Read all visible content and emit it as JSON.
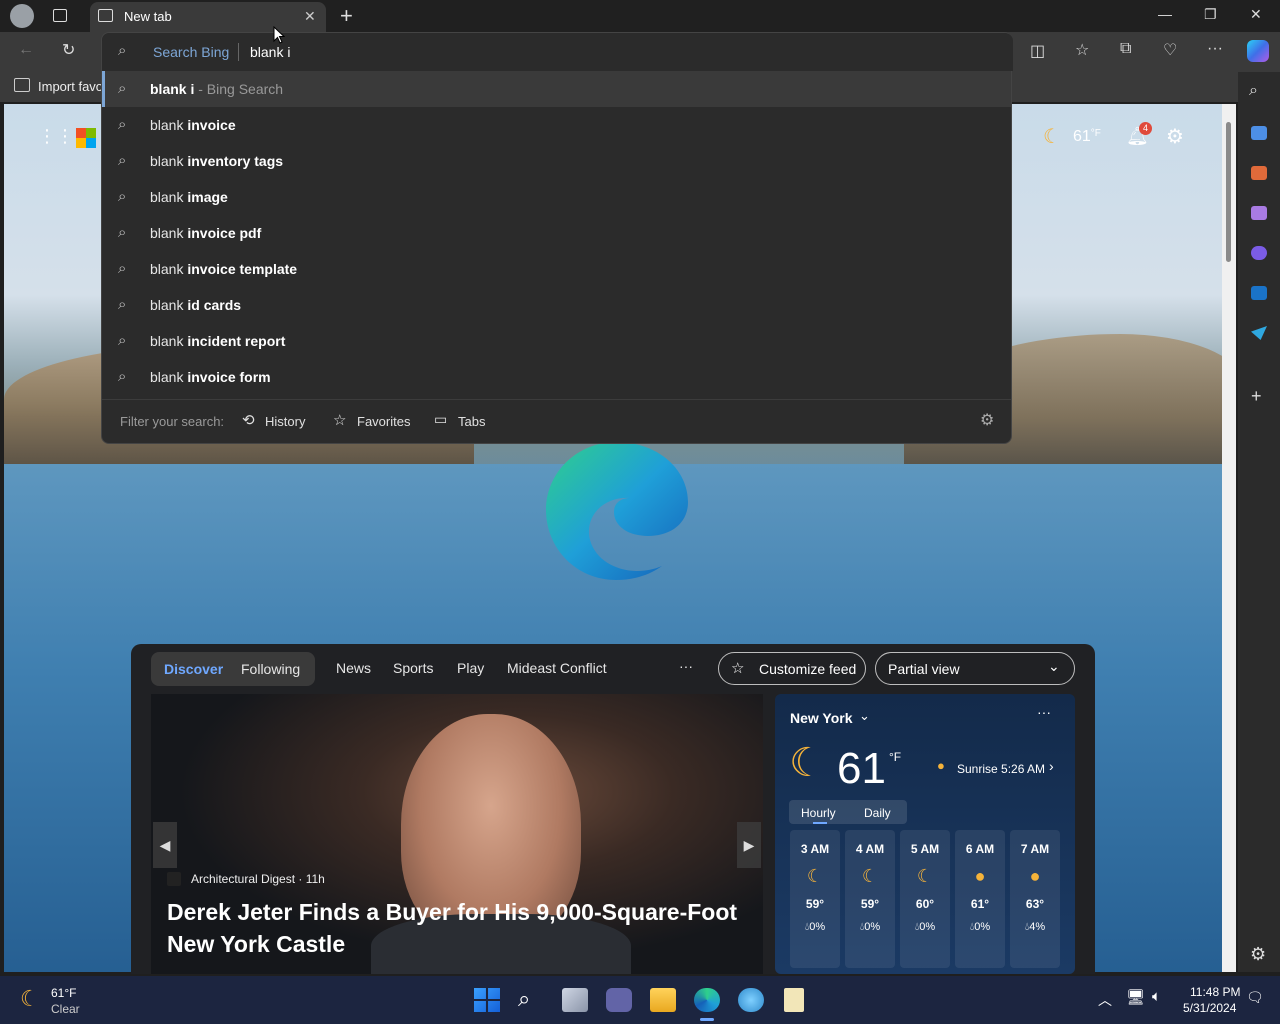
{
  "browser": {
    "tab_title": "New tab",
    "bookmark_import": "Import favo",
    "close_tab_glyph": "✕",
    "new_tab_glyph": "+"
  },
  "omnibox": {
    "engine_label": "Search Bing",
    "query": "blank i",
    "top_suggestion": {
      "query": "blank i",
      "suffix": " - Bing Search"
    },
    "suggestions": [
      {
        "prefix": "blank ",
        "bold": "invoice"
      },
      {
        "prefix": "blank ",
        "bold": "inventory tags"
      },
      {
        "prefix": "blank ",
        "bold": "image"
      },
      {
        "prefix": "blank ",
        "bold": "invoice pdf"
      },
      {
        "prefix": "blank ",
        "bold": "invoice template"
      },
      {
        "prefix": "blank ",
        "bold": "id cards"
      },
      {
        "prefix": "blank ",
        "bold": "incident report"
      },
      {
        "prefix": "blank ",
        "bold": "invoice form"
      }
    ],
    "filter_label": "Filter your search:",
    "filters": [
      "History",
      "Favorites",
      "Tabs"
    ]
  },
  "ntp": {
    "temp": "61",
    "temp_unit": "°F",
    "notification_count": "4"
  },
  "feed": {
    "tabs": [
      "Discover",
      "Following"
    ],
    "nav": [
      "News",
      "Sports",
      "Play",
      "Mideast Conflict"
    ],
    "more": "···",
    "customize": "Customize feed",
    "view_select": "Partial view",
    "hero": {
      "source": "Architectural Digest · 11h",
      "headline": "Derek Jeter Finds a Buyer for His 9,000-Square-Foot New York Castle"
    },
    "weather": {
      "city": "New York",
      "temp": "61",
      "unit": "°F",
      "sunrise": "Sunrise 5:26 AM",
      "tabs": [
        "Hourly",
        "Daily"
      ],
      "hours": [
        {
          "time": "3 AM",
          "icon": "moon-icon",
          "temp": "59°",
          "precip": "0%"
        },
        {
          "time": "4 AM",
          "icon": "moon-icon",
          "temp": "59°",
          "precip": "0%"
        },
        {
          "time": "5 AM",
          "icon": "moon-icon",
          "temp": "60°",
          "precip": "0%"
        },
        {
          "time": "6 AM",
          "icon": "sun-icon",
          "temp": "61°",
          "precip": "0%"
        },
        {
          "time": "7 AM",
          "icon": "sun-icon",
          "temp": "63°",
          "precip": "4%"
        }
      ]
    }
  },
  "taskbar": {
    "weather_temp": "61°F",
    "weather_desc": "Clear",
    "time": "11:48 PM",
    "date": "5/31/2024"
  },
  "colors": {
    "accent": "#5b9bd5",
    "omnibox_bg": "#2b2b2b",
    "taskbar_bg": "#1c2540"
  }
}
